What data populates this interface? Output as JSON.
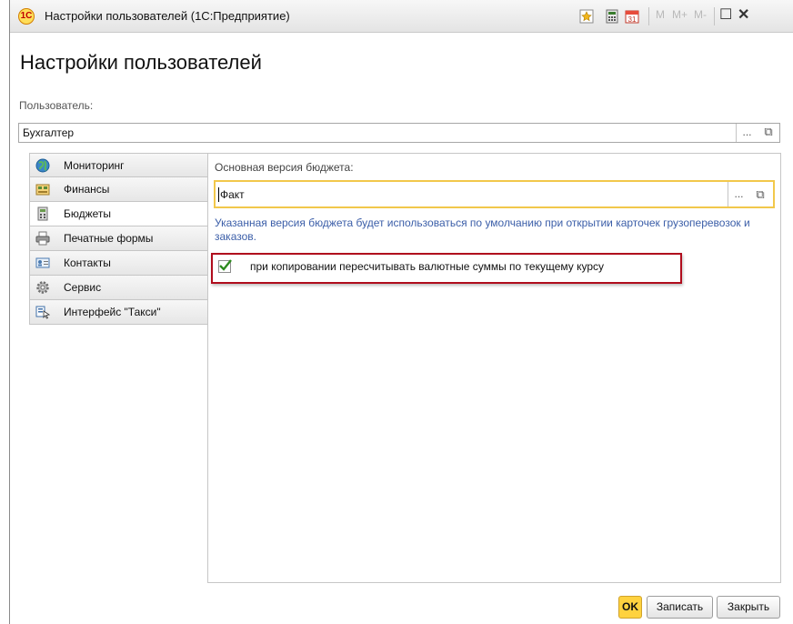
{
  "window": {
    "title": "Настройки пользователей  (1С:Предприятие)",
    "app_logo": "1С",
    "toolbar": {
      "m": "M",
      "m_plus": "M+",
      "m_minus": "M-",
      "calendar_day": "31"
    }
  },
  "page": {
    "title": "Настройки пользователей"
  },
  "user_field": {
    "label": "Пользователь:",
    "value": "Бухгалтер",
    "choose_label": "...",
    "open_icon": "open-window-icon"
  },
  "sidebar": {
    "items": [
      {
        "label": "Мониторинг",
        "icon": "globe-icon"
      },
      {
        "label": "Финансы",
        "icon": "finance-icon"
      },
      {
        "label": "Бюджеты",
        "icon": "calculator-icon",
        "active": true
      },
      {
        "label": "Печатные формы",
        "icon": "printer-icon"
      },
      {
        "label": "Контакты",
        "icon": "contact-card-icon"
      },
      {
        "label": "Сервис",
        "icon": "gear-icon"
      },
      {
        "label": "Интерфейс \"Такси\"",
        "icon": "interface-icon"
      }
    ]
  },
  "budget": {
    "label": "Основная версия бюджета:",
    "value": "Факт",
    "choose_label": "...",
    "hint": "Указанная версия бюджета будет использоваться по умолчанию при открытии карточек грузоперевозок и заказов.",
    "recalc_checkbox": {
      "label": "при копировании пересчитывать валютные суммы по текущему курсу",
      "checked": true
    }
  },
  "buttons": {
    "ok": "OK",
    "save": "Записать",
    "close": "Закрыть"
  },
  "colors": {
    "accent_yellow": "#f2c84b",
    "highlight_red": "#b00d1d",
    "hint_blue": "#3b5ea8",
    "check_green": "#2e8b1f"
  }
}
